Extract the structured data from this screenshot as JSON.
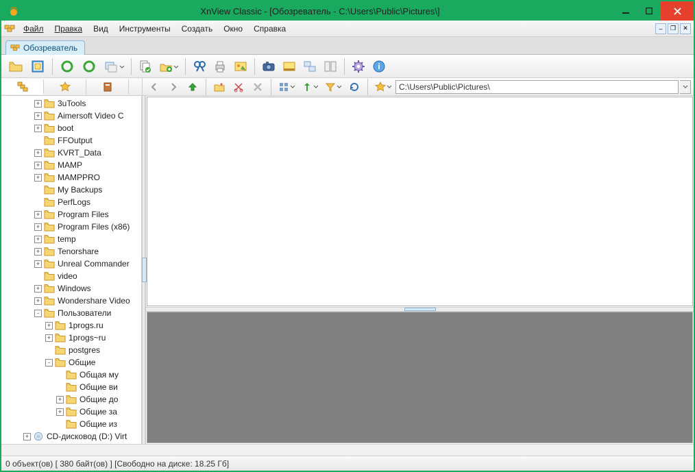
{
  "title": "XnView Classic - [Обозреватель - C:\\Users\\Public\\Pictures\\]",
  "menu": {
    "file": "Файл",
    "edit": "Правка",
    "view": "Вид",
    "tools": "Инструменты",
    "create": "Создать",
    "window": "Окно",
    "help": "Справка"
  },
  "tab": {
    "label": "Обозреватель"
  },
  "address": {
    "path": "C:\\Users\\Public\\Pictures\\"
  },
  "tree": [
    {
      "indent": 3,
      "exp": "+",
      "label": "3uTools"
    },
    {
      "indent": 3,
      "exp": "+",
      "label": "Aimersoft Video C"
    },
    {
      "indent": 3,
      "exp": "+",
      "label": "boot"
    },
    {
      "indent": 3,
      "exp": "",
      "label": "FFOutput"
    },
    {
      "indent": 3,
      "exp": "+",
      "label": "KVRT_Data"
    },
    {
      "indent": 3,
      "exp": "+",
      "label": "MAMP"
    },
    {
      "indent": 3,
      "exp": "+",
      "label": "MAMPPRO"
    },
    {
      "indent": 3,
      "exp": "",
      "label": "My Backups"
    },
    {
      "indent": 3,
      "exp": "",
      "label": "PerfLogs"
    },
    {
      "indent": 3,
      "exp": "+",
      "label": "Program Files"
    },
    {
      "indent": 3,
      "exp": "+",
      "label": "Program Files (x86)"
    },
    {
      "indent": 3,
      "exp": "+",
      "label": "temp"
    },
    {
      "indent": 3,
      "exp": "+",
      "label": "Tenorshare"
    },
    {
      "indent": 3,
      "exp": "+",
      "label": "Unreal Commander"
    },
    {
      "indent": 3,
      "exp": "",
      "label": "video"
    },
    {
      "indent": 3,
      "exp": "+",
      "label": "Windows"
    },
    {
      "indent": 3,
      "exp": "+",
      "label": "Wondershare Video"
    },
    {
      "indent": 3,
      "exp": "-",
      "label": "Пользователи"
    },
    {
      "indent": 4,
      "exp": "+",
      "label": "1progs.ru"
    },
    {
      "indent": 4,
      "exp": "+",
      "label": "1progs~ru"
    },
    {
      "indent": 4,
      "exp": "",
      "label": "postgres"
    },
    {
      "indent": 4,
      "exp": "-",
      "label": "Общие"
    },
    {
      "indent": 5,
      "exp": "",
      "label": "Общая му"
    },
    {
      "indent": 5,
      "exp": "",
      "label": "Общие ви"
    },
    {
      "indent": 5,
      "exp": "+",
      "label": "Общие до"
    },
    {
      "indent": 5,
      "exp": "+",
      "label": "Общие за"
    },
    {
      "indent": 5,
      "exp": "",
      "label": "Общие из"
    },
    {
      "indent": 2,
      "exp": "+",
      "label": "CD-дисковод (D:) Virt",
      "icon": "cd"
    }
  ],
  "status": "0 объект(ов) [ 380 байт(ов) ] [Свободно на диске: 18.25 Гб]"
}
